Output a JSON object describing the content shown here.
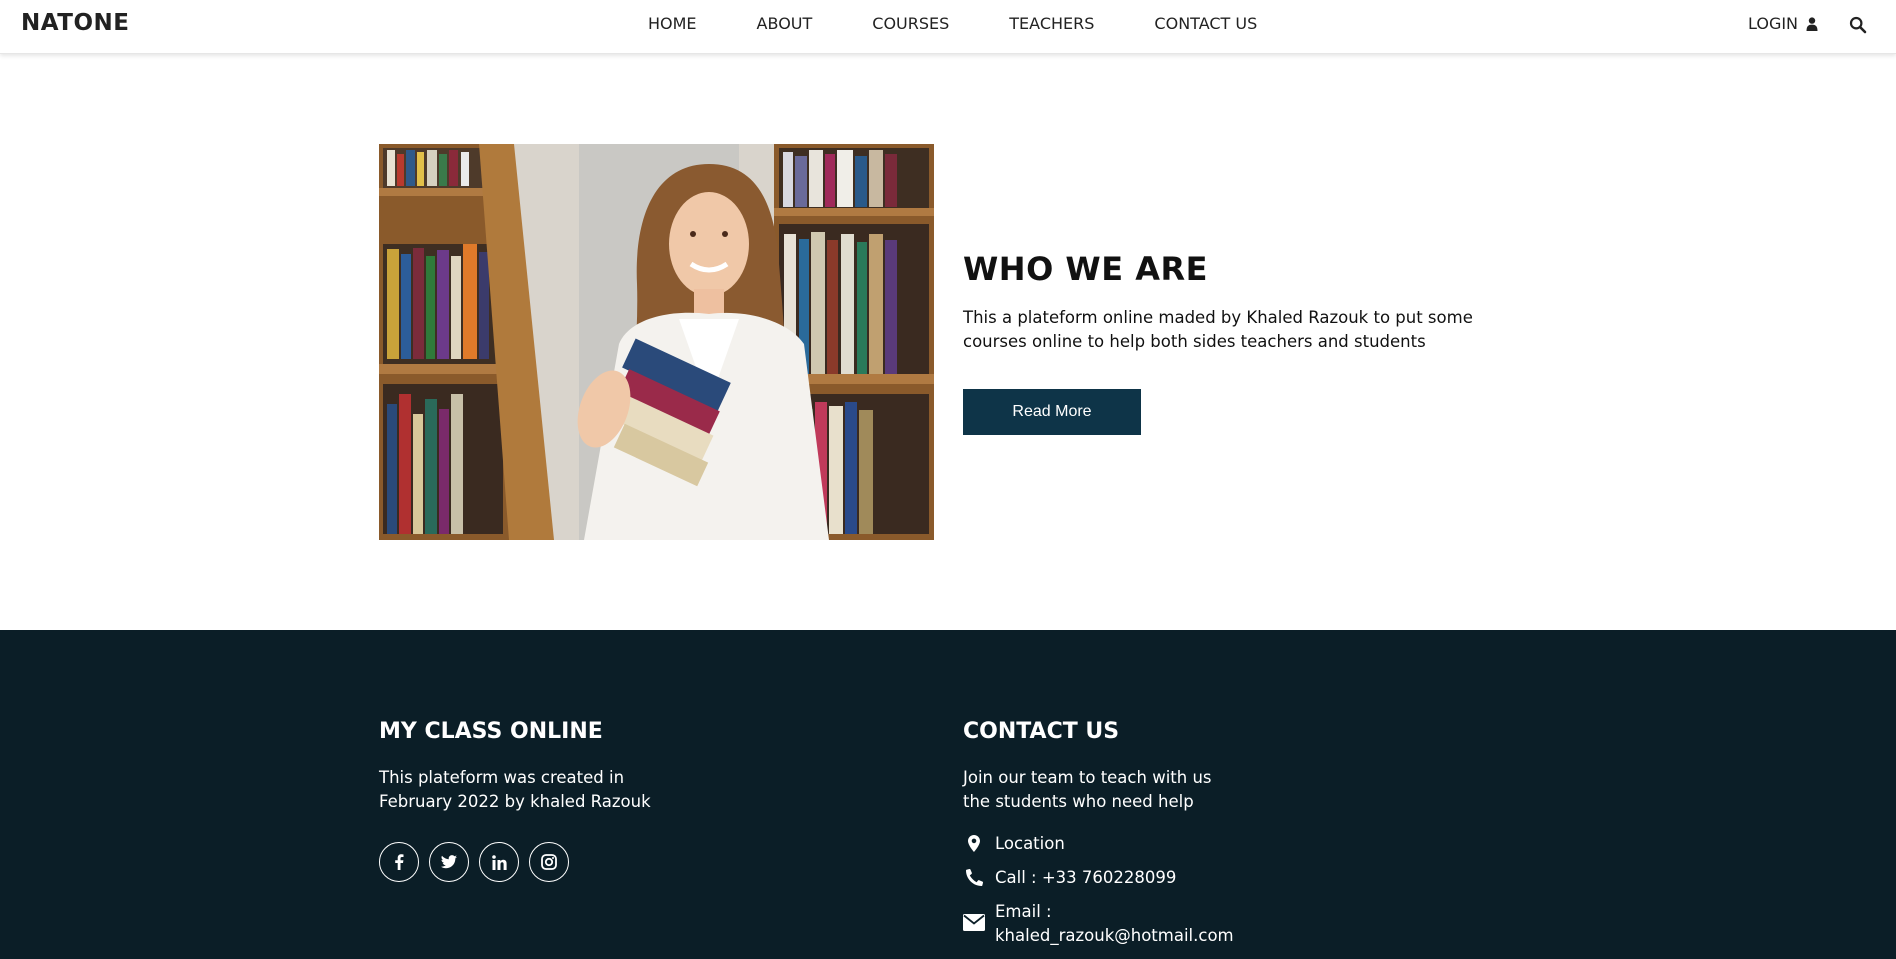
{
  "header": {
    "logo": "NATONE",
    "nav": [
      "HOME",
      "ABOUT",
      "COURSES",
      "TEACHERS",
      "CONTACT US"
    ],
    "login_label": "LOGIN",
    "icons": {
      "login": "user-icon",
      "search": "search-icon"
    }
  },
  "about": {
    "title": "WHO WE ARE",
    "description": "This a plateform online maded by Khaled Razouk to put some courses online to help both sides teachers and students",
    "button_label": "Read More",
    "image": "woman-holding-books-in-library"
  },
  "footer": {
    "left": {
      "title": "MY CLASS ONLINE",
      "text_line1": "This plateform was created in",
      "text_line2": "February 2022 by khaled Razouk",
      "social_icons": [
        "facebook-icon",
        "twitter-icon",
        "linkedin-icon",
        "instagram-icon"
      ]
    },
    "right": {
      "title": "CONTACT US",
      "text_line1": "Join our team to teach with us",
      "text_line2": "the students who need help",
      "location": "Location",
      "call": "Call : +33 760228099",
      "email_label": "Email :",
      "email": "khaled_razouk@hotmail.com"
    }
  },
  "colors": {
    "button": "#0e3448",
    "footer_bg": "#0b1e27"
  }
}
